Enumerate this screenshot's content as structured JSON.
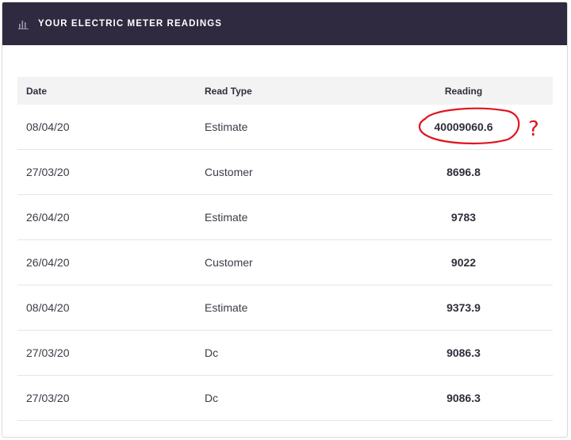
{
  "panel": {
    "title": "YOUR ELECTRIC METER READINGS",
    "icon": "bar-chart-icon"
  },
  "table": {
    "columns": [
      "Date",
      "Read Type",
      "Reading"
    ],
    "rows": [
      {
        "date": "08/04/20",
        "type": "Estimate",
        "reading": "40009060.6"
      },
      {
        "date": "27/03/20",
        "type": "Customer",
        "reading": "8696.8"
      },
      {
        "date": "26/04/20",
        "type": "Estimate",
        "reading": "9783"
      },
      {
        "date": "26/04/20",
        "type": "Customer",
        "reading": "9022"
      },
      {
        "date": "08/04/20",
        "type": "Estimate",
        "reading": "9373.9"
      },
      {
        "date": "27/03/20",
        "type": "Dc",
        "reading": "9086.3"
      },
      {
        "date": "27/03/20",
        "type": "Dc",
        "reading": "9086.3"
      }
    ]
  },
  "annotation": {
    "mark": "?",
    "color": "#e0141e"
  },
  "colors": {
    "header_bg": "#2f2a40",
    "table_header_bg": "#f3f3f3"
  }
}
